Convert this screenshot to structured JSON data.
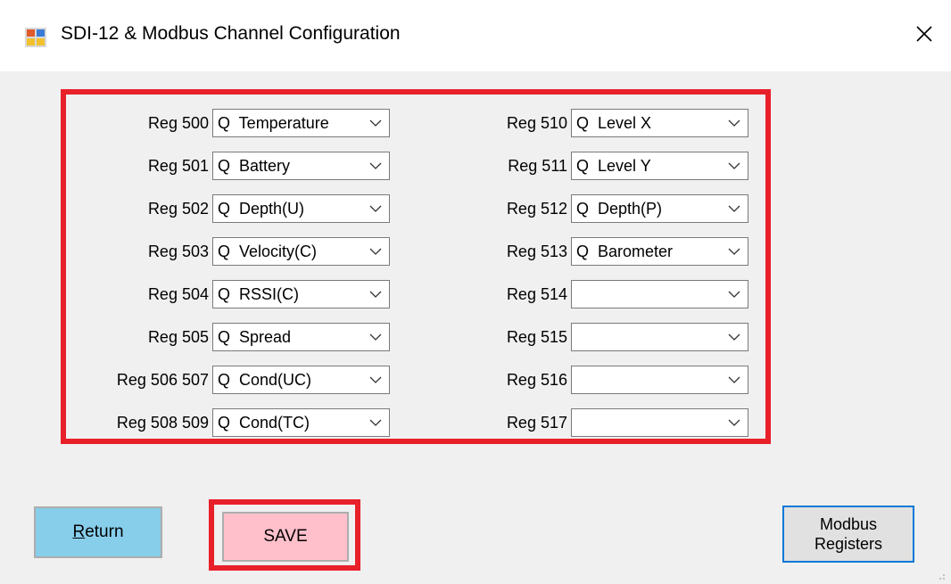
{
  "window": {
    "title": "SDI-12 & Modbus Channel Configuration",
    "close_glyph": "✕"
  },
  "left_rows": [
    {
      "label": "Reg 500",
      "value": "Q  Temperature"
    },
    {
      "label": "Reg 501",
      "value": "Q  Battery"
    },
    {
      "label": "Reg 502",
      "value": "Q  Depth(U)"
    },
    {
      "label": "Reg 503",
      "value": "Q  Velocity(C)"
    },
    {
      "label": "Reg 504",
      "value": "Q  RSSI(C)"
    },
    {
      "label": "Reg 505",
      "value": "Q  Spread"
    },
    {
      "label": "Reg 506 507",
      "value": "Q  Cond(UC)"
    },
    {
      "label": "Reg 508 509",
      "value": "Q  Cond(TC)"
    }
  ],
  "right_rows": [
    {
      "label": "Reg 510",
      "value": "Q  Level X"
    },
    {
      "label": "Reg 511",
      "value": "Q  Level Y"
    },
    {
      "label": "Reg 512",
      "value": "Q  Depth(P)"
    },
    {
      "label": "Reg 513",
      "value": "Q  Barometer"
    },
    {
      "label": "Reg 514",
      "value": ""
    },
    {
      "label": "Reg 515",
      "value": ""
    },
    {
      "label": "Reg 516",
      "value": ""
    },
    {
      "label": "Reg 517",
      "value": ""
    }
  ],
  "buttons": {
    "return_first": "R",
    "return_rest": "eturn",
    "save": "SAVE",
    "modbus_line1": "Modbus",
    "modbus_line2": "Registers"
  },
  "colors": {
    "highlight_border": "#e8202a",
    "return_bg": "#87ceeb",
    "save_bg": "#ffc0cb",
    "modbus_border": "#0078d7"
  }
}
